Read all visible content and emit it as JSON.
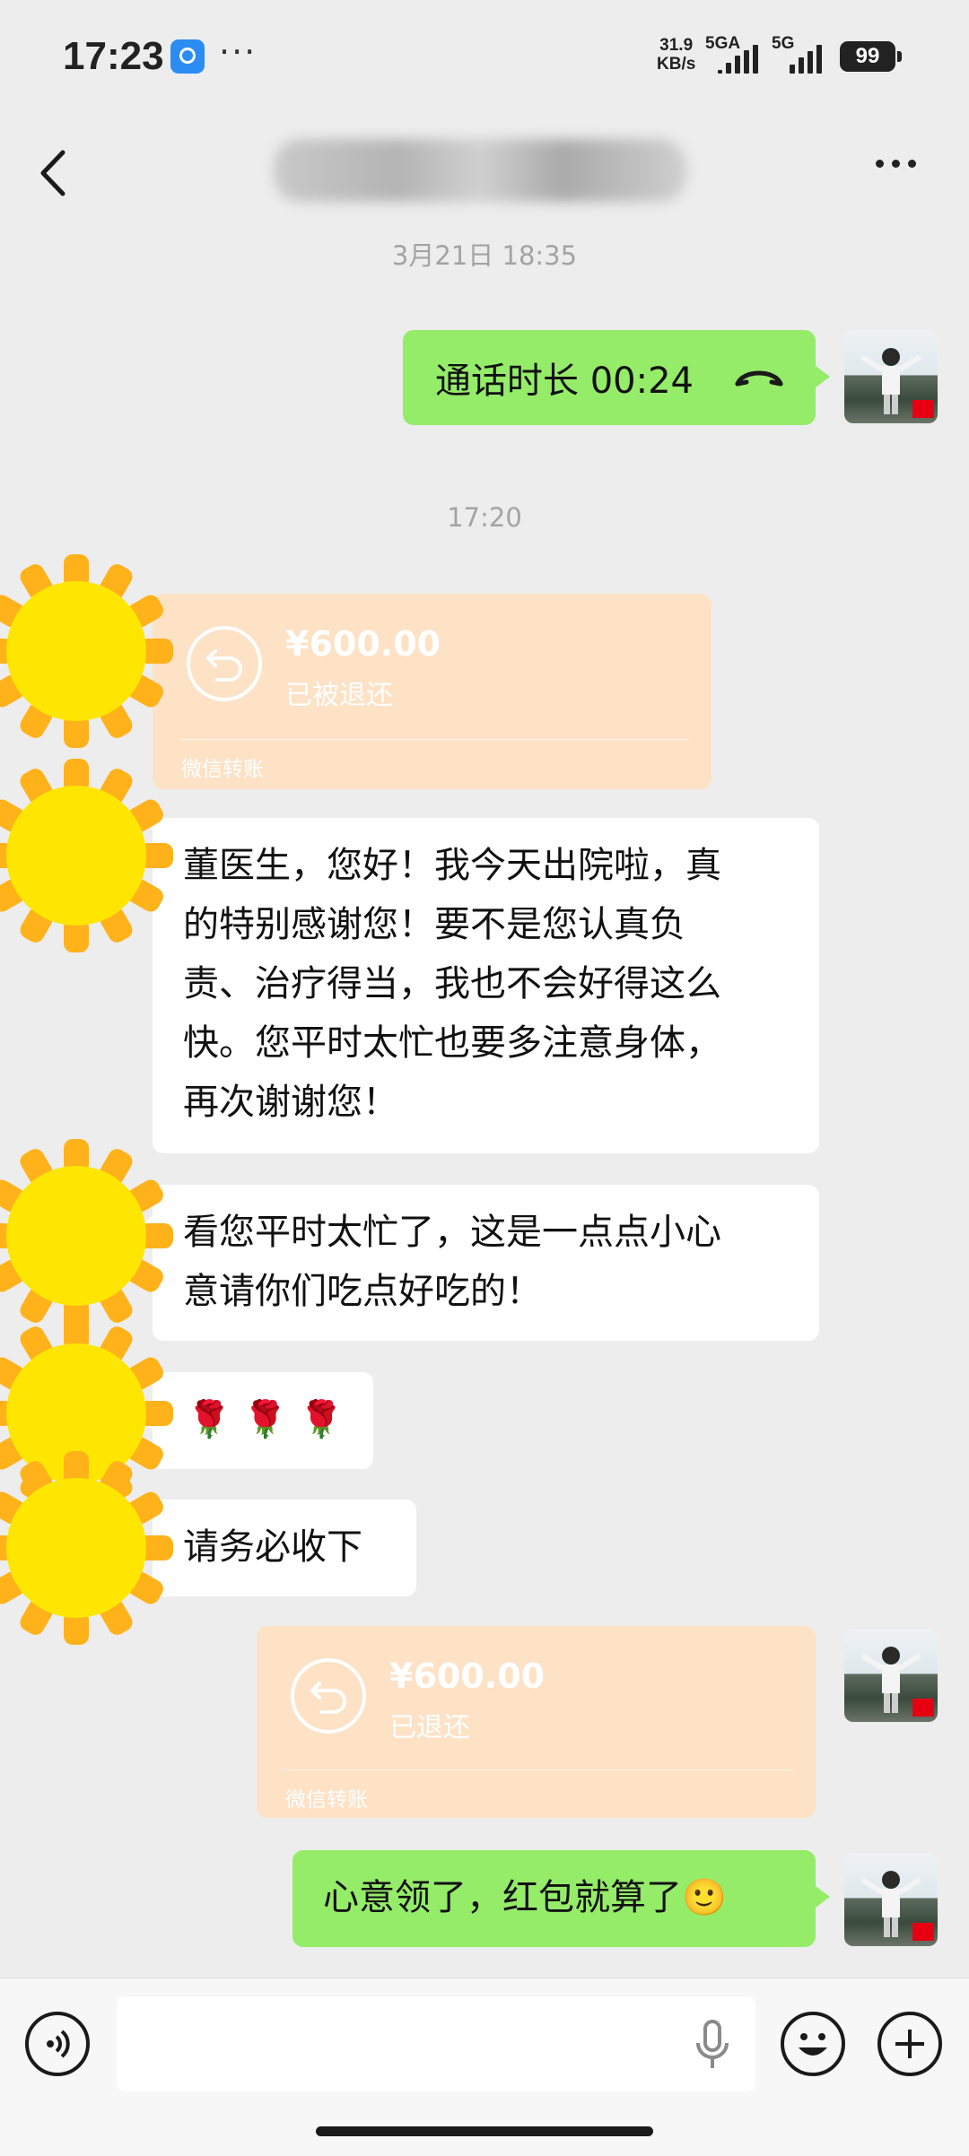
{
  "status_bar": {
    "time": "17:23",
    "more": "···",
    "net_speed_value": "31.9",
    "net_speed_unit": "KB/s",
    "signal1_label": "5GA",
    "signal2_label": "5G",
    "battery": "99"
  },
  "header": {
    "title": ""
  },
  "messages": {
    "timestamp1": "3月21日 18:35",
    "call_text": "通话时长 00:24",
    "timestamp2": "17:20",
    "transfer1": {
      "amount": "¥600.00",
      "status": "已被退还",
      "footer": "微信转账"
    },
    "msg1": [
      "董医生，您好！我今天出院啦，真",
      "的特别感谢您！要不是您认真负",
      "责、治疗得当，我也不会好得这么",
      "快。您平时太忙也要多注意身体，",
      "再次谢谢您！"
    ],
    "msg2": [
      "看您平时太忙了，这是一点点小心",
      "意请你们吃点好吃的！"
    ],
    "msg3": "🌹 🌹 🌹",
    "msg4": "请务必收下",
    "transfer2": {
      "amount": "¥600.00",
      "status": "已退还",
      "footer": "微信转账"
    },
    "msg5": "心意领了，红包就算了",
    "msg5_emoji": "🙂"
  },
  "icons": {
    "back": "back-arrow-icon",
    "more": "more-icon",
    "voice": "voice-input-icon",
    "mic": "mic-icon",
    "emoji": "emoji-icon",
    "plus": "plus-icon",
    "call": "phone-hangup-icon",
    "transfer": "transfer-return-icon"
  },
  "colors": {
    "sent_bubble": "#95ec69",
    "received_bubble": "#ffffff",
    "transfer_card": "#fde2c6",
    "sticker_sun": "#ffe600",
    "background": "#ededed"
  }
}
